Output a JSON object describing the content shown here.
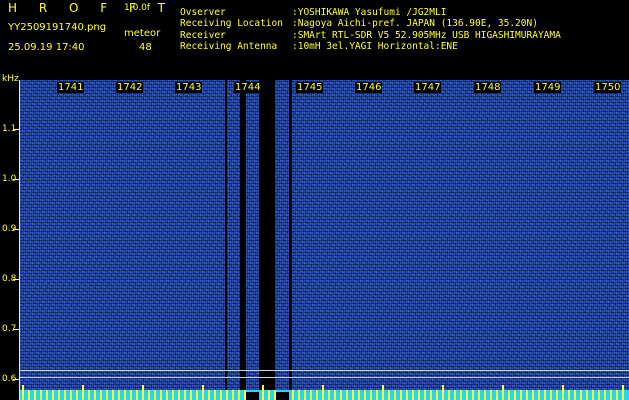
{
  "app": {
    "brand": "H R O F F T",
    "version": "1.0.0f"
  },
  "file": {
    "name": "YY2509191740.png",
    "timestamp": "25.09.19 17:40"
  },
  "meteor": {
    "label": "meteor",
    "count": "48"
  },
  "info": {
    "observer_label": "Ovserver",
    "observer_value": ":YOSHIKAWA Yasufumi /JG2MLI",
    "location_label": "Receiving Location",
    "location_value": ":Nagoya Aichi-pref. JAPAN (136.90E, 35.20N)",
    "receiver_label": "Receiver",
    "receiver_value": ":SMArt RTL-SDR V5 52.905MHz USB HIGASHIMURAYAMA",
    "antenna_label": "Receiving Antenna",
    "antenna_value": ":10mH 3el.YAGI Horizontal:ENE"
  },
  "axis": {
    "unit": "kHz",
    "y_ticks": [
      "1.1",
      "1.0",
      "0.9",
      "0.8",
      "0.7",
      "0.6"
    ],
    "x_ticks": [
      "1741",
      "1742",
      "1743",
      "1744",
      "1745",
      "1746",
      "1747",
      "1748",
      "1749",
      "1750"
    ]
  },
  "colors": {
    "label": "#ffff33",
    "spectrum": "#123a9e",
    "baseline": "#22d8f5"
  }
}
